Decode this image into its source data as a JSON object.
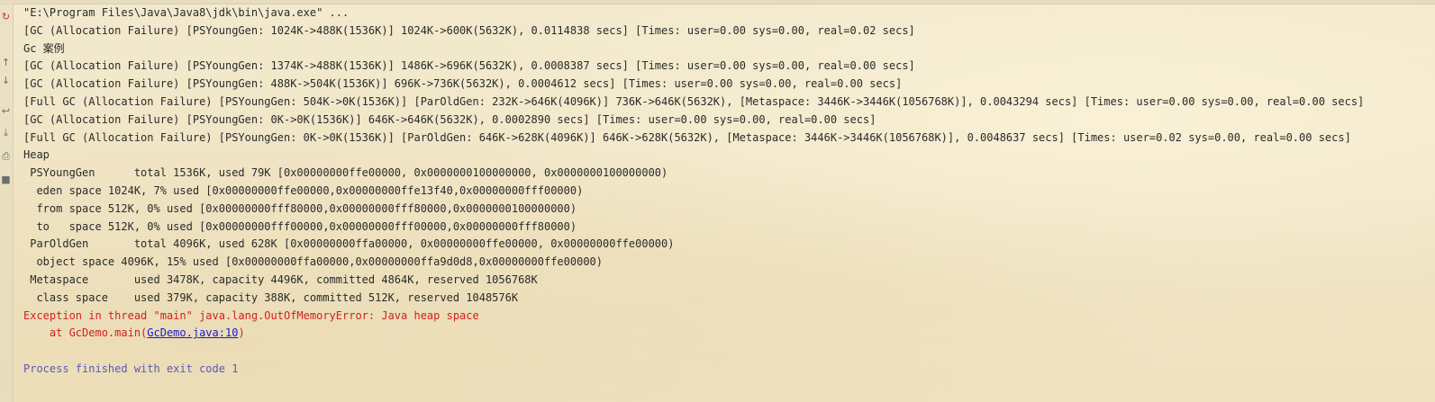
{
  "console": {
    "lines": [
      {
        "text": "\"E:\\Program Files\\Java\\Java8\\jdk\\bin\\java.exe\" ...",
        "type": "normal"
      },
      {
        "text": "[GC (Allocation Failure) [PSYoungGen: 1024K->488K(1536K)] 1024K->600K(5632K), 0.0114838 secs] [Times: user=0.00 sys=0.00, real=0.02 secs]",
        "type": "normal"
      },
      {
        "text": "Gc 案例",
        "type": "normal"
      },
      {
        "text": "[GC (Allocation Failure) [PSYoungGen: 1374K->488K(1536K)] 1486K->696K(5632K), 0.0008387 secs] [Times: user=0.00 sys=0.00, real=0.00 secs]",
        "type": "normal"
      },
      {
        "text": "[GC (Allocation Failure) [PSYoungGen: 488K->504K(1536K)] 696K->736K(5632K), 0.0004612 secs] [Times: user=0.00 sys=0.00, real=0.00 secs]",
        "type": "normal"
      },
      {
        "text": "[Full GC (Allocation Failure) [PSYoungGen: 504K->0K(1536K)] [ParOldGen: 232K->646K(4096K)] 736K->646K(5632K), [Metaspace: 3446K->3446K(1056768K)], 0.0043294 secs] [Times: user=0.00 sys=0.00, real=0.00 secs]",
        "type": "normal"
      },
      {
        "text": "[GC (Allocation Failure) [PSYoungGen: 0K->0K(1536K)] 646K->646K(5632K), 0.0002890 secs] [Times: user=0.00 sys=0.00, real=0.00 secs]",
        "type": "normal"
      },
      {
        "text": "[Full GC (Allocation Failure) [PSYoungGen: 0K->0K(1536K)] [ParOldGen: 646K->628K(4096K)] 646K->628K(5632K), [Metaspace: 3446K->3446K(1056768K)], 0.0048637 secs] [Times: user=0.02 sys=0.00, real=0.00 secs]",
        "type": "normal"
      },
      {
        "text": "Heap",
        "type": "normal"
      },
      {
        "text": " PSYoungGen      total 1536K, used 79K [0x00000000ffe00000, 0x0000000100000000, 0x0000000100000000)",
        "type": "normal"
      },
      {
        "text": "  eden space 1024K, 7% used [0x00000000ffe00000,0x00000000ffe13f40,0x00000000fff00000)",
        "type": "normal"
      },
      {
        "text": "  from space 512K, 0% used [0x00000000fff80000,0x00000000fff80000,0x0000000100000000)",
        "type": "normal"
      },
      {
        "text": "  to   space 512K, 0% used [0x00000000fff00000,0x00000000fff00000,0x00000000fff80000)",
        "type": "normal"
      },
      {
        "text": " ParOldGen       total 4096K, used 628K [0x00000000ffa00000, 0x00000000ffe00000, 0x00000000ffe00000)",
        "type": "normal"
      },
      {
        "text": "  object space 4096K, 15% used [0x00000000ffa00000,0x00000000ffa9d0d8,0x00000000ffe00000)",
        "type": "normal"
      },
      {
        "text": " Metaspace       used 3478K, capacity 4496K, committed 4864K, reserved 1056768K",
        "type": "normal"
      },
      {
        "text": "  class space    used 379K, capacity 388K, committed 512K, reserved 1048576K",
        "type": "normal"
      },
      {
        "text": "Exception in thread \"main\" java.lang.OutOfMemoryError: Java heap space",
        "type": "error"
      }
    ],
    "stack_line": {
      "prefix": "    at GcDemo.main(",
      "link": "GcDemo.java:10",
      "suffix": ")"
    },
    "blank": "",
    "process_line": "Process finished with exit code 1"
  },
  "toolbar": {
    "icons": [
      "rerun-icon",
      "arrow-up-icon",
      "arrow-down-icon",
      "soft-wrap-icon",
      "scroll-to-end-icon",
      "print-icon",
      "trash-icon"
    ]
  },
  "colors": {
    "background": "#f1e6c8",
    "text": "#2a2a2a",
    "error": "#d21f1f",
    "link": "#1a1ad6",
    "process": "#5a5ab5"
  }
}
